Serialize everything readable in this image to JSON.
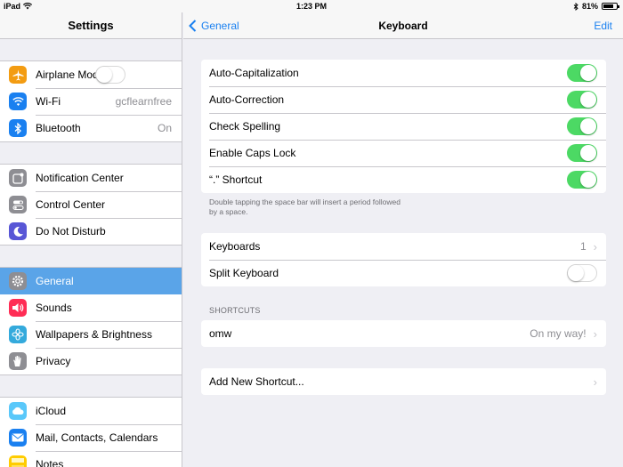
{
  "status": {
    "device": "iPad",
    "time": "1:23 PM",
    "battery": "81%",
    "battery_level": 0.81
  },
  "sidebar": {
    "title": "Settings",
    "groups": [
      [
        {
          "label": "Airplane Mode",
          "icon": "airplane-icon",
          "color": "#f39c12",
          "toggle": "off"
        },
        {
          "label": "Wi-Fi",
          "icon": "wifi-icon",
          "color": "#1a80f0",
          "value": "gcflearnfree"
        },
        {
          "label": "Bluetooth",
          "icon": "bluetooth-icon",
          "color": "#1a80f0",
          "value": "On"
        }
      ],
      [
        {
          "label": "Notification Center",
          "icon": "notification-icon",
          "color": "#8e8e93"
        },
        {
          "label": "Control Center",
          "icon": "control-center-icon",
          "color": "#8e8e93"
        },
        {
          "label": "Do Not Disturb",
          "icon": "moon-icon",
          "color": "#5856d6"
        }
      ],
      [
        {
          "label": "General",
          "icon": "gear-icon",
          "color": "#8e8e93",
          "selected": true
        },
        {
          "label": "Sounds",
          "icon": "speaker-icon",
          "color": "#ff2d55"
        },
        {
          "label": "Wallpapers & Brightness",
          "icon": "flower-icon",
          "color": "#34aadc"
        },
        {
          "label": "Privacy",
          "icon": "hand-icon",
          "color": "#8e8e93"
        }
      ],
      [
        {
          "label": "iCloud",
          "icon": "cloud-icon",
          "color": "#5ac8fa"
        },
        {
          "label": "Mail, Contacts, Calendars",
          "icon": "mail-icon",
          "color": "#1a80f0"
        },
        {
          "label": "Notes",
          "icon": "notes-icon",
          "color": "#ffcc00"
        }
      ]
    ]
  },
  "nav": {
    "back_label": "General",
    "title": "Keyboard",
    "edit_label": "Edit"
  },
  "keyboard_settings": [
    {
      "label": "Auto-Capitalization",
      "state": "on"
    },
    {
      "label": "Auto-Correction",
      "state": "on"
    },
    {
      "label": "Check Spelling",
      "state": "on"
    },
    {
      "label": "Enable Caps Lock",
      "state": "on"
    },
    {
      "label": "“.” Shortcut",
      "state": "on"
    }
  ],
  "footer_note": "Double tapping the space bar will insert a period followed by a space.",
  "keyboards_group": {
    "keyboards": {
      "label": "Keyboards",
      "value": "1"
    },
    "split": {
      "label": "Split Keyboard",
      "state": "off"
    }
  },
  "shortcuts": {
    "header": "SHORTCUTS",
    "item": {
      "label": "omw",
      "value": "On my way!"
    },
    "add_label": "Add New Shortcut..."
  },
  "colors": {
    "accent": "#1a80f0",
    "toggle_on": "#4cd964",
    "selected_row": "#5aa4e8"
  }
}
